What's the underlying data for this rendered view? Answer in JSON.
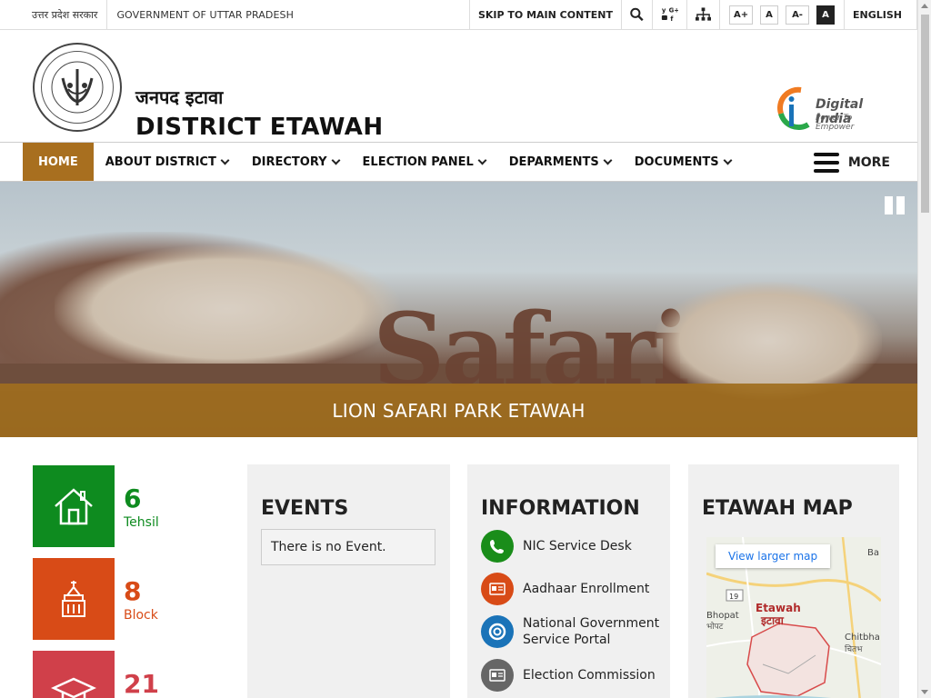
{
  "topbar": {
    "hindi_gov": "उत्तर प्रदेश सरकार",
    "gov_name": "GOVERNMENT OF UTTAR PRADESH",
    "skip_link": "SKIP TO MAIN CONTENT",
    "font_sizes": [
      "A+",
      "A",
      "A-",
      "A"
    ],
    "language": "ENGLISH"
  },
  "header": {
    "district_hindi": "जनपद इटावा",
    "district_title": "DISTRICT ETAWAH",
    "emblem_text": "उत्तर प्रदेश सरकार",
    "digital_india": "Digital India",
    "digital_india_sub": "Power To Empower"
  },
  "nav": {
    "items": [
      {
        "label": "HOME",
        "dropdown": false
      },
      {
        "label": "ABOUT DISTRICT",
        "dropdown": true
      },
      {
        "label": "DIRECTORY",
        "dropdown": true
      },
      {
        "label": "ELECTION PANEL",
        "dropdown": true
      },
      {
        "label": "DEPARMENTS",
        "dropdown": true
      },
      {
        "label": "DOCUMENTS",
        "dropdown": true
      }
    ],
    "more": "MORE"
  },
  "slider": {
    "sign_text": "Safari",
    "caption": "LION SAFARI PARK ETAWAH"
  },
  "stats": [
    {
      "value": "6",
      "label": "Tehsil",
      "color": "#0e8b1f"
    },
    {
      "value": "8",
      "label": "Block",
      "color": "#d84b17"
    },
    {
      "value": "21",
      "label": "",
      "color": "#d0404a"
    }
  ],
  "events": {
    "title": "EVENTS",
    "empty": "There is no Event."
  },
  "information": {
    "title": "INFORMATION",
    "items": [
      {
        "label": "NIC Service Desk",
        "icon": "phone-icon",
        "color": "#1a8d1a"
      },
      {
        "label": "Aadhaar Enrollment",
        "icon": "id-card-icon",
        "color": "#d84b17"
      },
      {
        "label": "National Government Service Portal",
        "icon": "lifebuoy-icon",
        "color": "#1a73b8"
      },
      {
        "label": "Election Commission",
        "icon": "ballot-card-icon",
        "color": "#666666"
      }
    ]
  },
  "map": {
    "title": "ETAWAH MAP",
    "larger_map": "View larger map",
    "road_badge": "19",
    "labels": [
      "Etawah",
      "इटावा",
      "Bhopat",
      "भोपट",
      "Chitbha",
      "चितभ",
      "Ba"
    ]
  },
  "colors": {
    "accent": "#a86f1f",
    "tehsil": "#0e8b1f",
    "block": "#d84b17",
    "third": "#d0404a"
  }
}
